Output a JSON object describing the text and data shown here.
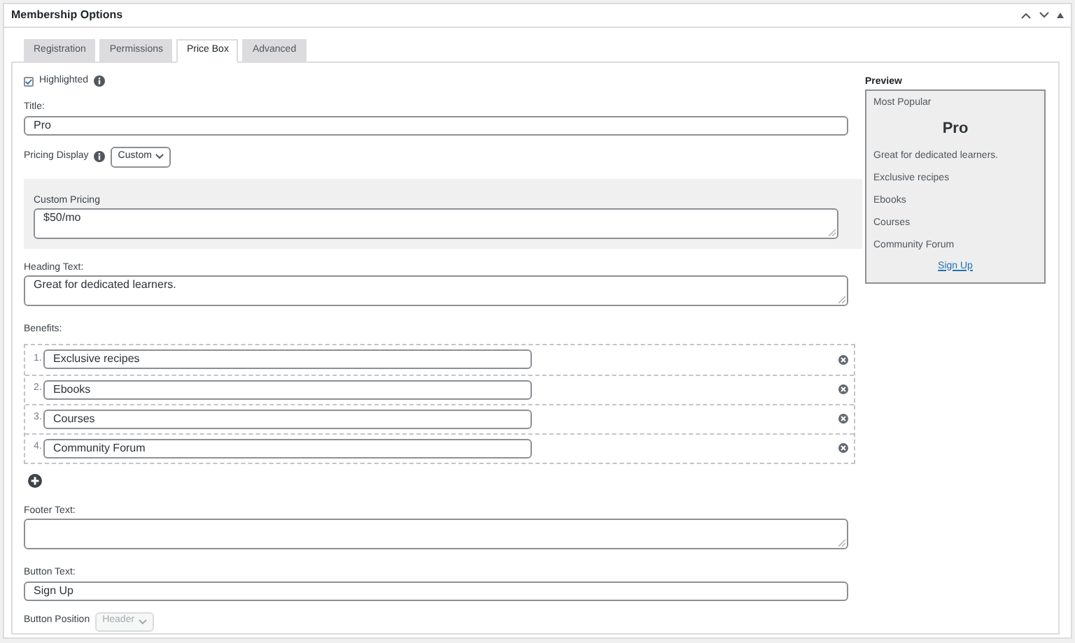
{
  "panel": {
    "title": "Membership Options"
  },
  "tabs": [
    {
      "label": "Registration",
      "selected": false
    },
    {
      "label": "Permissions",
      "selected": false
    },
    {
      "label": "Price Box",
      "selected": true
    },
    {
      "label": "Advanced",
      "selected": false
    }
  ],
  "highlighted": {
    "label": "Highlighted",
    "checked": true
  },
  "title_field": {
    "label": "Title:",
    "value": "Pro"
  },
  "pricing_display": {
    "label": "Pricing Display",
    "value": "Custom"
  },
  "custom_pricing": {
    "label": "Custom Pricing",
    "value": "$50/mo"
  },
  "heading_text": {
    "label": "Heading Text:",
    "value": "Great for dedicated learners."
  },
  "benefits": {
    "label": "Benefits:",
    "items": [
      {
        "number": "1.",
        "value": "Exclusive recipes"
      },
      {
        "number": "2.",
        "value": "Ebooks"
      },
      {
        "number": "3.",
        "value": "Courses"
      },
      {
        "number": "4.",
        "value": "Community Forum"
      }
    ]
  },
  "footer_text": {
    "label": "Footer Text:"
  },
  "button_text": {
    "label": "Button Text:",
    "value": "Sign Up"
  },
  "button_position": {
    "label": "Button Position",
    "value": "Header",
    "disabled": true
  },
  "preview": {
    "title": "Preview",
    "badge": "Most Popular",
    "name": "Pro",
    "heading": "Great for dedicated learners.",
    "benefits": [
      "Exclusive recipes",
      "Ebooks",
      "Courses",
      "Community Forum"
    ],
    "button": "Sign Up"
  }
}
